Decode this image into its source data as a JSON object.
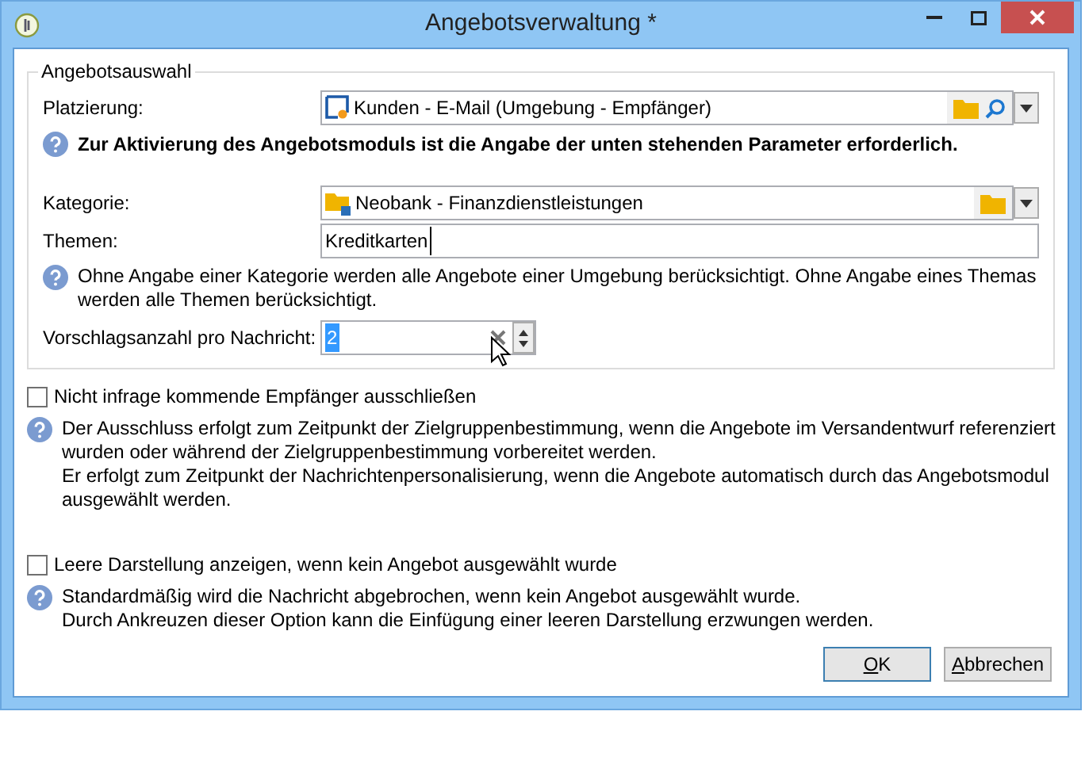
{
  "window": {
    "title": "Angebotsverwaltung *"
  },
  "group": {
    "title": "Angebotsauswahl",
    "placement": {
      "label": "Platzierung:",
      "value": "Kunden - E-Mail (Umgebung - Empfänger)"
    },
    "notice": "Zur Aktivierung des Angebotsmoduls ist die Angabe der unten stehenden Parameter erforderlich.",
    "category": {
      "label": "Kategorie:",
      "value": "Neobank - Finanzdienstleistungen"
    },
    "themes": {
      "label": "Themen:",
      "value": "Kreditkarten"
    },
    "hint": [
      "Ohne Angabe einer Kategorie werden alle Angebote einer Umgebung berücksichtigt. Ohne Angabe eines Themas",
      "werden alle Themen berücksichtigt."
    ],
    "count": {
      "label": "Vorschlagsanzahl pro Nachricht:",
      "value": "2",
      "selected": true
    }
  },
  "options": [
    {
      "label": "Nicht infrage kommende Empfänger ausschließen",
      "checked": false,
      "help": [
        "Der Ausschluss erfolgt zum Zeitpunkt der Zielgruppenbestimmung, wenn die Angebote im Versandentwurf referenziert",
        "wurden oder während der Zielgruppenbestimmung vorbereitet werden.",
        "Er erfolgt zum Zeitpunkt der Nachrichtenpersonalisierung, wenn die Angebote automatisch durch das Angebotsmodul",
        "ausgewählt werden."
      ]
    },
    {
      "label": "Leere Darstellung anzeigen, wenn kein Angebot ausgewählt wurde",
      "checked": false,
      "help": [
        "Standardmäßig wird die Nachricht abgebrochen, wenn kein Angebot ausgewählt wurde.",
        "Durch Ankreuzen dieser Option kann die Einfügung einer leeren Darstellung erzwungen werden."
      ]
    }
  ],
  "buttons": [
    {
      "label": "OK",
      "default": true,
      "underline_first": true
    },
    {
      "label": "Abbrechen",
      "default": false,
      "underline_first": true
    }
  ]
}
